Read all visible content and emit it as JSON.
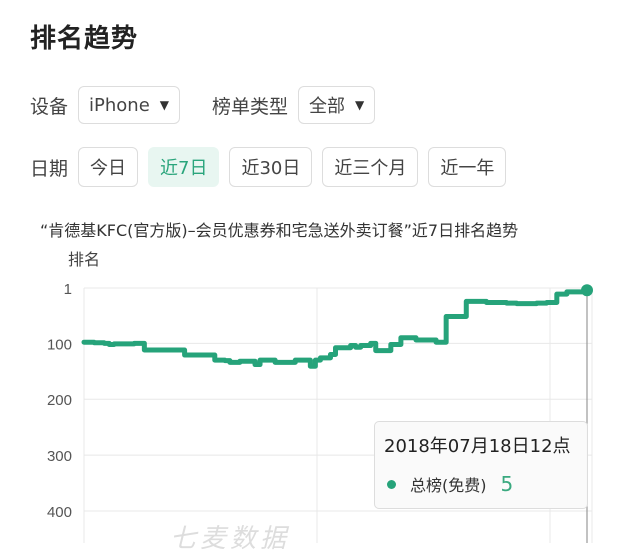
{
  "header": {
    "title": "排名趋势"
  },
  "filters": {
    "device_label": "设备",
    "device_value": "iPhone",
    "list_type_label": "榜单类型",
    "list_type_value": "全部",
    "caret": "▼"
  },
  "date_range": {
    "label": "日期",
    "options": [
      {
        "label": "今日",
        "active": false
      },
      {
        "label": "近7日",
        "active": true
      },
      {
        "label": "近30日",
        "active": false
      },
      {
        "label": "近三个月",
        "active": false
      },
      {
        "label": "近一年",
        "active": false
      }
    ]
  },
  "colors": {
    "accent": "#26a37a",
    "active_bg": "#e8f6f1",
    "grid": "#e8e8e8"
  },
  "watermark": "七麦数据",
  "tooltip": {
    "date": "2018年07月18日12点",
    "series_name": "总榜(免费)",
    "value": "5"
  },
  "chart_data": {
    "type": "line",
    "title": "“肯德基KFC(官方版)–会员优惠券和宅急送外卖订餐”近7日排名趋势",
    "ylabel": "排名",
    "xlabel": "",
    "y_inverted": true,
    "ylim": [
      1,
      420
    ],
    "y_ticks": [
      1,
      100,
      200,
      300,
      400
    ],
    "grid": true,
    "series": [
      {
        "name": "总榜(免费)",
        "color": "#26a37a",
        "x": [
          0,
          2,
          4,
          5,
          6,
          8,
          10,
          12,
          13,
          16,
          17,
          20,
          21,
          23,
          24,
          26,
          27,
          28,
          29,
          31,
          32,
          34,
          35,
          37,
          38,
          40,
          41,
          42,
          43,
          44,
          45,
          46,
          47,
          49,
          50,
          51,
          53,
          54,
          55,
          57,
          58,
          60,
          61,
          62,
          63,
          65,
          66,
          68,
          70,
          72,
          74,
          76,
          78,
          80,
          82,
          84,
          86,
          88,
          90,
          92,
          94,
          96,
          100
        ],
        "values": [
          98,
          99,
          100,
          102,
          101,
          101,
          100,
          112,
          112,
          112,
          112,
          121,
          121,
          121,
          121,
          130,
          130,
          131,
          134,
          132,
          132,
          138,
          130,
          130,
          134,
          134,
          134,
          130,
          130,
          130,
          141,
          130,
          126,
          120,
          108,
          108,
          104,
          107,
          104,
          100,
          113,
          113,
          102,
          102,
          90,
          90,
          94,
          94,
          98,
          52,
          52,
          25,
          25,
          27,
          27,
          28,
          29,
          29,
          28,
          27,
          12,
          8,
          5
        ]
      }
    ]
  }
}
